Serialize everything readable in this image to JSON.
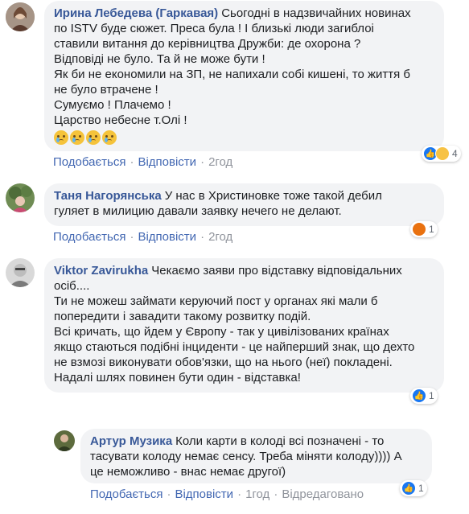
{
  "comments": [
    {
      "author": "Ирина Лебедева (Гаркавая)",
      "lines": [
        "Сьогодні в надзвичайних новинах",
        "по ISTV буде сюжет. Преса була ! І близькі люди загиблоі",
        "ставили витання до керівництва Дружби: де охорона ?",
        "Відповіді не було. Та й не може бути !",
        "Як би не економили на ЗП, не напихали собі кишені, то життя б",
        "не було втрачене !",
        "Сумуємо ! Плачемо !",
        "Царство небесне т.Олі !"
      ],
      "emoji_count": 4,
      "like_label": "Подобається",
      "replies_label": "Відповісти",
      "time": "2год",
      "reaction_count": "4",
      "reaction_icons": [
        "like-icon",
        "sad-icon"
      ]
    },
    {
      "author": "Таня Нагорянська",
      "lines": [
        "У нас в Христиновке тоже такой дебил",
        "гуляет в милицию давали заявку нечего не делают."
      ],
      "like_label": "Подобається",
      "replies_label": "Відповісти",
      "time": "2год",
      "reaction_count": "1",
      "reaction_icons": [
        "angry-icon"
      ]
    },
    {
      "author": "Viktor Zavirukha",
      "lines": [
        "Чекаємо заяви про відставку відповідальних",
        "осіб....",
        "Ти не можеш займати керуючий пост у органах які мали б",
        "попередити і завадити такому розвитку подій.",
        "Всі кричать, що йдем у Європу - так у цивілізованих країнах",
        "якщо стаються подібні інциденти - це найперший знак, що дехто",
        "не взмозі виконувати обов'язки, що на нього (неї) покладені.",
        "Надалі шлях повинен бути один - відставка!"
      ],
      "like_label": "Подобається",
      "replies_label": "Відповісти",
      "time": "2год",
      "reaction_count": "1",
      "reaction_icons": [
        "like-icon"
      ]
    },
    {
      "author": "Артур Музика",
      "lines": [
        "Коли карти в колоді всі позначені - то",
        "тасувати колоду немає сенсу. Треба міняти колоду)))) А",
        "це неможливо - внас немає другої)"
      ],
      "like_label": "Подобається",
      "replies_label": "Відповісти",
      "time": "1год",
      "edited_label": "Відредаговано",
      "reaction_count": "1",
      "reaction_icons": [
        "like-icon"
      ]
    }
  ],
  "colors": {
    "author": "#385898",
    "link": "#4267b2",
    "meta": "#90949c",
    "bubble": "#f2f3f5",
    "like": "#1877f2",
    "sad": "#f7c244",
    "angry": "#e9710f"
  }
}
